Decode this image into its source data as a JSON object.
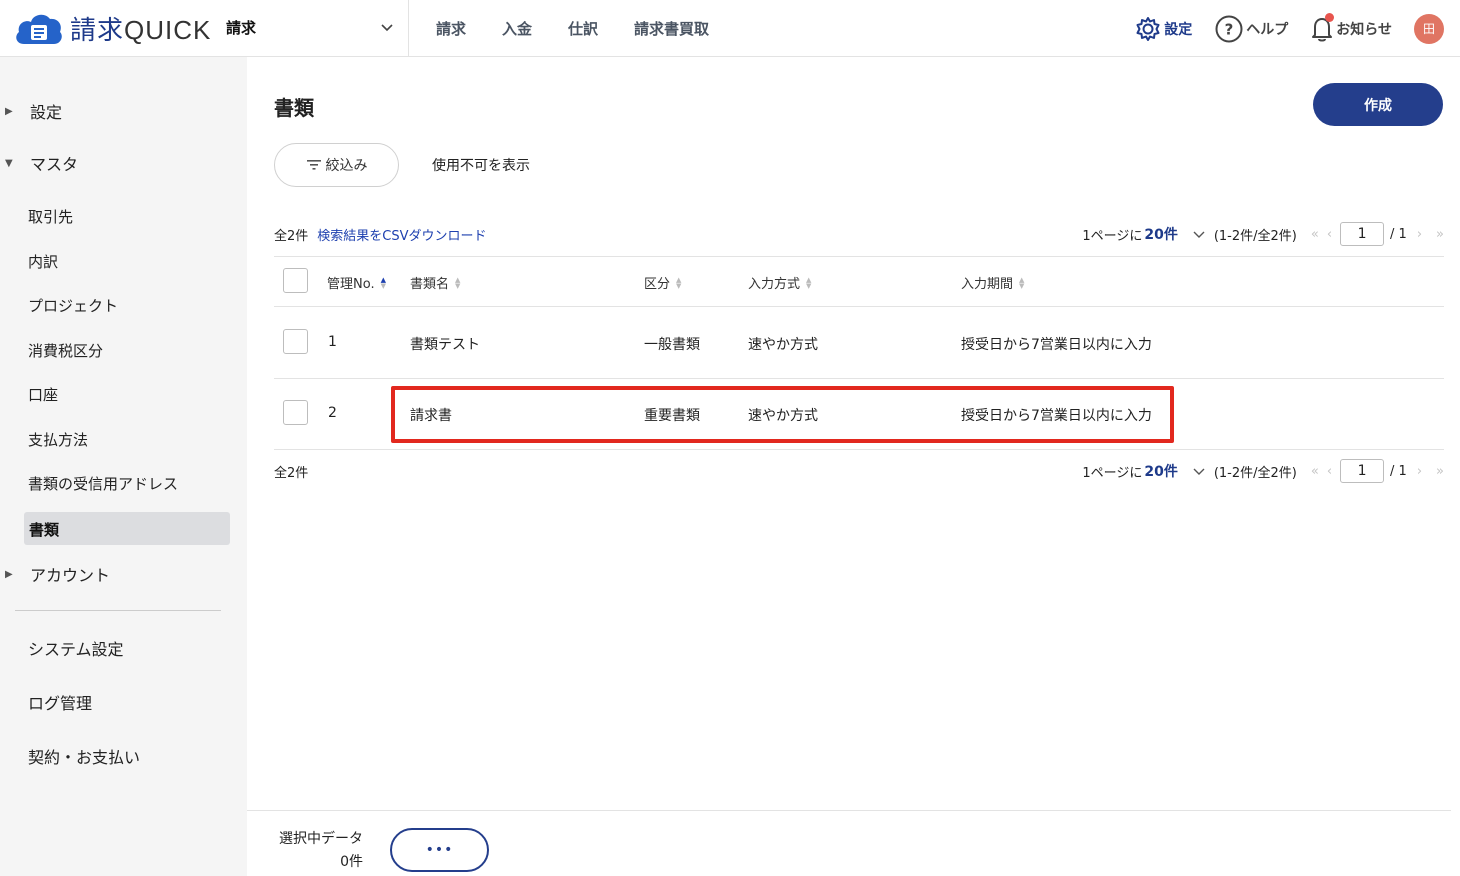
{
  "header": {
    "logo_main": "請求",
    "logo_sub": "QUICK",
    "app_select": "請求",
    "nav": [
      "請求",
      "入金",
      "仕訳",
      "請求書買取"
    ],
    "settings": "設定",
    "help": "ヘルプ",
    "notice": "お知らせ",
    "avatar": "田"
  },
  "sidebar": {
    "groups": {
      "settings": "設定",
      "master": "マスタ",
      "account": "アカウント"
    },
    "master_items": [
      "取引先",
      "内訳",
      "プロジェクト",
      "消費税区分",
      "口座",
      "支払方法",
      "書類の受信用アドレス"
    ],
    "active_item": "書類",
    "bottom_items": [
      "システム設定",
      "ログ管理",
      "契約・お支払い"
    ]
  },
  "main": {
    "title": "書類",
    "create_button": "作成",
    "filter_button": "絞込み",
    "show_disabled": "使用不可を表示",
    "total_count": "全2件",
    "csv_link": "検索結果をCSVダウンロード",
    "pager": {
      "per_prefix": "1ページに",
      "per_value": "20件",
      "range": "(1-2件/全2件)",
      "page": "1",
      "of": "/ 1"
    },
    "columns": [
      "管理No.",
      "書類名",
      "区分",
      "入力方式",
      "入力期間"
    ],
    "rows": [
      {
        "no": "1",
        "name": "書類テスト",
        "category": "一般書類",
        "method": "速やか方式",
        "period": "授受日から7営業日以内に入力"
      },
      {
        "no": "2",
        "name": "請求書",
        "category": "重要書類",
        "method": "速やか方式",
        "period": "授受日から7営業日以内に入力"
      }
    ]
  },
  "footer": {
    "selected_label": "選択中データ",
    "selected_count": "0件",
    "more_button": "•••"
  }
}
